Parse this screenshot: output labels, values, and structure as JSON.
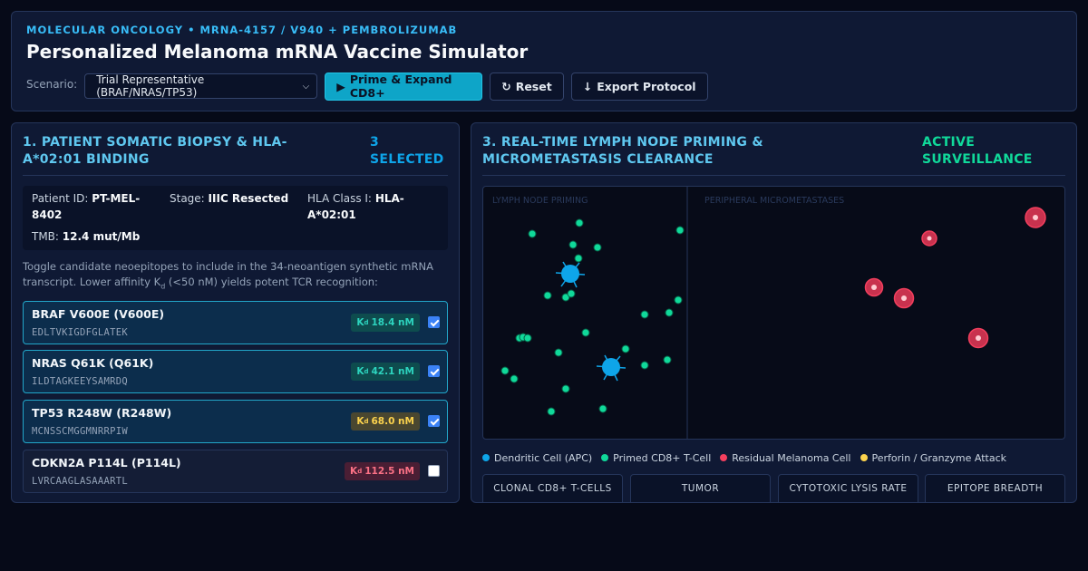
{
  "header": {
    "eyebrow": "MOLECULAR ONCOLOGY • MRNA-4157 / V940 + PEMBROLIZUMAB",
    "title": "Personalized Melanoma mRNA Vaccine Simulator",
    "scenario_label": "Scenario:",
    "scenario_selected": "Trial Representative (BRAF/NRAS/TP53)",
    "prime_label": "Prime & Expand CD8+",
    "reset_label": "Reset",
    "export_label": "Export Protocol"
  },
  "biopsy": {
    "title": "1. PATIENT SOMATIC BIOPSY & HLA-A*02:01 BINDING",
    "selected_badge": "3 SELECTED",
    "patient_id_label": "Patient ID:",
    "patient_id": "PT-MEL-8402",
    "stage_label": "Stage:",
    "stage": "IIIC Resected",
    "hla_label": "HLA Class I:",
    "hla": "HLA-A*02:01",
    "tmb_label": "TMB:",
    "tmb": "12.4 mut/Mb",
    "desc_a": "Toggle candidate neoepitopes to include in the 34-neoantigen synthetic mRNA transcript. Lower affinity K",
    "desc_sub": "d",
    "desc_b": " (<50 nM) yields potent TCR recognition:",
    "kd_prefix": "K",
    "kd_sub": "d",
    "epitopes": [
      {
        "name": "BRAF V600E (V600E)",
        "seq": "EDLTVKIGDFGLATEK",
        "kd": "18.4 nM",
        "level": "good",
        "checked": true
      },
      {
        "name": "NRAS Q61K (Q61K)",
        "seq": "ILDTAGKEEYSAMRDQ",
        "kd": "42.1 nM",
        "level": "good",
        "checked": true
      },
      {
        "name": "TP53 R248W (R248W)",
        "seq": "MCNSSCMGGMNRRPIW",
        "kd": "68.0 nM",
        "level": "mid",
        "checked": true
      },
      {
        "name": "CDKN2A P114L (P114L)",
        "seq": "LVRCAAGLASAAARTL",
        "kd": "112.5 nM",
        "level": "bad",
        "checked": false
      }
    ]
  },
  "simulation": {
    "title": "3. REAL-TIME LYMPH NODE PRIMING & MICROMETASTASIS CLEARANCE",
    "status": "ACTIVE SURVEILLANCE",
    "zone_left": "LYMPH NODE PRIMING",
    "zone_right": "PERIPHERAL MICROMETASTASES",
    "legend": [
      {
        "label": "Dendritic Cell (APC)",
        "color": "#0ea5e9"
      },
      {
        "label": "Primed CD8+ T-Cell",
        "color": "#10d99a"
      },
      {
        "label": "Residual Melanoma Cell",
        "color": "#f43f5e"
      },
      {
        "label": "Perforin / Granzyme Attack",
        "color": "#fcd34d"
      }
    ],
    "stats": [
      {
        "label": "CLONAL CD8+ T-CELLS"
      },
      {
        "label": "TUMOR"
      },
      {
        "label": "CYTOTOXIC LYSIS RATE"
      },
      {
        "label": "EPITOPE BREADTH"
      }
    ]
  },
  "colors": {
    "accent": "#0ea5c8",
    "t_cell": "#10d99a",
    "dendritic": "#0ea5e9",
    "tumor": "#f43f5e"
  }
}
